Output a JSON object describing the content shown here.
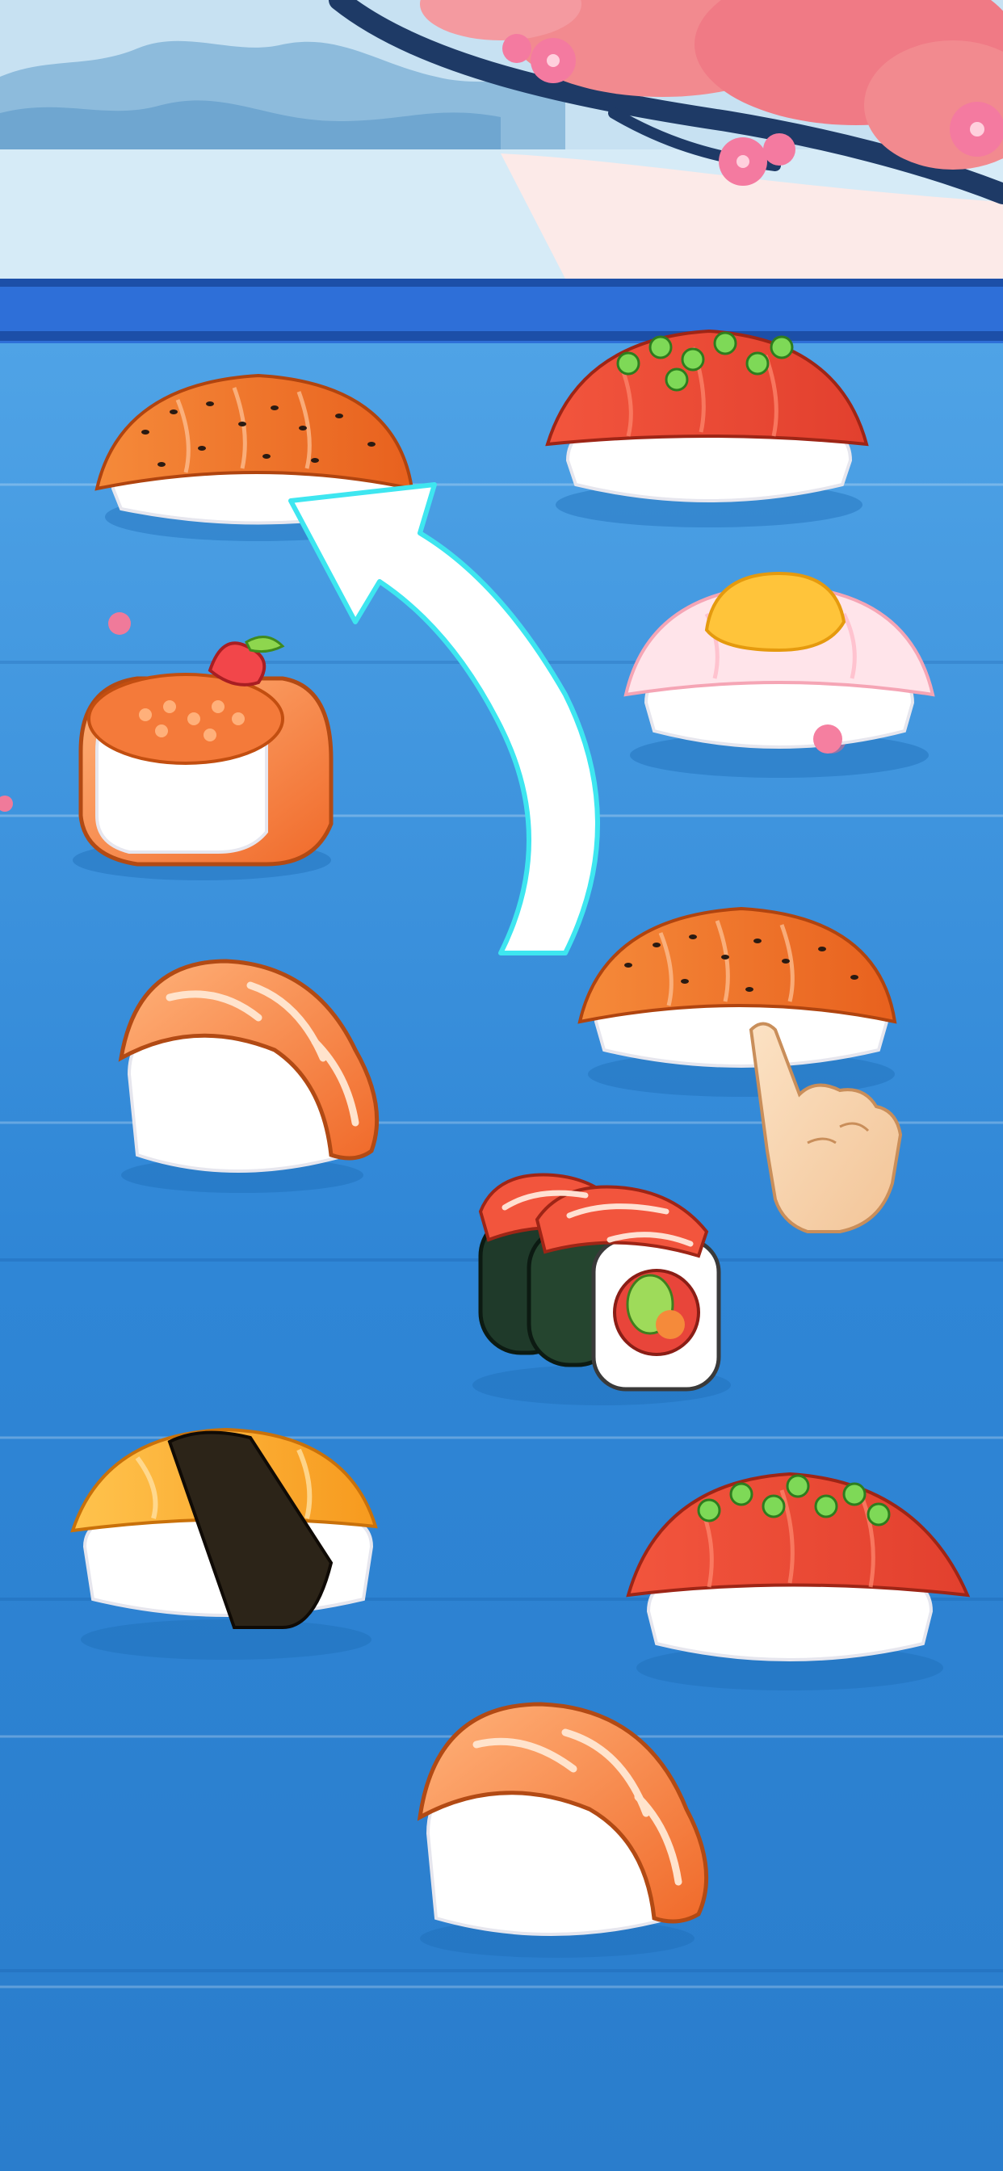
{
  "scene": {
    "name": "sushi-matching-board",
    "colors": {
      "sky": "#BFDDF0",
      "mountain": "#7FB1D6",
      "water": "#CFE6F5",
      "blossom": "#F07F8C",
      "branch": "#1E3A66",
      "rail": "#2E6FD8",
      "table": "#2F8BD9",
      "arrow_outline": "#3EE6F0"
    }
  },
  "pieces": [
    {
      "id": "seared-sesame-nigiri-1",
      "kind": "nigiri-seared-sesame"
    },
    {
      "id": "tuna-scallion-nigiri-1",
      "kind": "nigiri-tuna-scallion"
    },
    {
      "id": "squid-egg-nigiri",
      "kind": "nigiri-squid-egg"
    },
    {
      "id": "salmon-roe-gunkan",
      "kind": "gunkan-roe-strawberry"
    },
    {
      "id": "salmon-nigiri-1",
      "kind": "nigiri-salmon"
    },
    {
      "id": "seared-sesame-nigiri-2",
      "kind": "nigiri-seared-sesame"
    },
    {
      "id": "salmon-maki-roll",
      "kind": "maki-salmon-avocado"
    },
    {
      "id": "tamago-nigiri",
      "kind": "nigiri-tamago-nori"
    },
    {
      "id": "tuna-scallion-nigiri-2",
      "kind": "nigiri-tuna-scallion"
    },
    {
      "id": "salmon-nigiri-2",
      "kind": "nigiri-salmon"
    }
  ],
  "tutorial": {
    "hint": "drag-to-match",
    "from_piece": "seared-sesame-nigiri-2",
    "to_piece": "seared-sesame-nigiri-1",
    "arrow_icon": "curved-arrow-icon",
    "pointer_icon": "pointing-hand-icon"
  }
}
